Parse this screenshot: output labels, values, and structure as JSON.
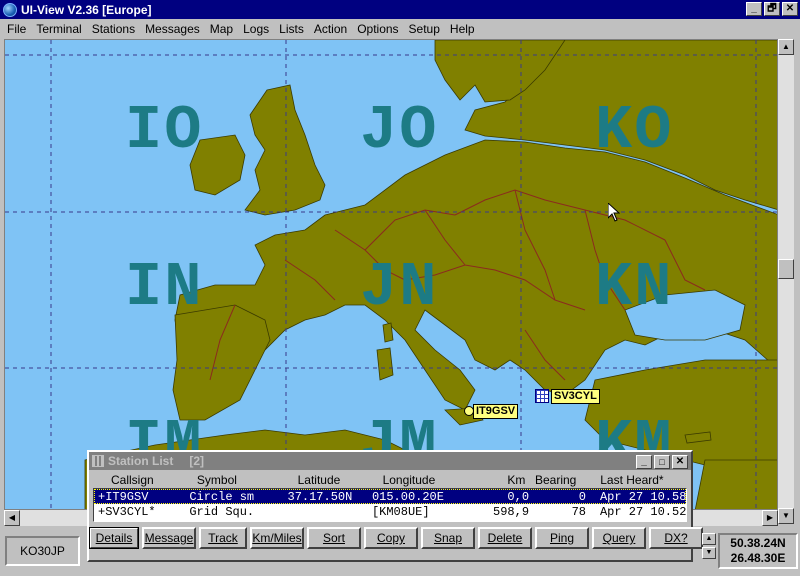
{
  "window": {
    "title": "UI-View V2.36 [Europe]",
    "buttons": [
      "_",
      "🗗",
      "✕"
    ]
  },
  "menu": [
    "File",
    "Terminal",
    "Stations",
    "Messages",
    "Map",
    "Logs",
    "Lists",
    "Action",
    "Options",
    "Setup",
    "Help"
  ],
  "map": {
    "grid_squares": [
      "IO",
      "JO",
      "KO",
      "IN",
      "JN",
      "KN",
      "IM",
      "JM",
      "KM"
    ],
    "stations": [
      {
        "callsign": "IT9GSV",
        "symbol": "circle"
      },
      {
        "callsign": "SV3CYL",
        "symbol": "grid"
      }
    ],
    "colors": {
      "sea": "#7fc3f5",
      "land": "#808000",
      "grid_labels": "#1d7b85",
      "borders": "#8b2a1e"
    }
  },
  "station_list": {
    "title": "Station List",
    "count": "[2]",
    "columns": [
      "Callsign",
      "Symbol",
      "Latitude",
      "Longitude",
      "Km",
      "Bearing",
      "Last Heard*"
    ],
    "rows": [
      {
        "callsign": "+IT9GSV",
        "symbol": "Circle sm",
        "latitude": "37.17.50N",
        "longitude": "015.00.20E",
        "km": "0,0",
        "bearing": "0",
        "last_heard": "Apr 27 10.58",
        "selected": true
      },
      {
        "callsign": "+SV3CYL*",
        "symbol": "Grid Squ.",
        "latitude": "",
        "longitude": "[KM08UE]",
        "km": "598,9",
        "bearing": "78",
        "last_heard": "Apr 27 10.52",
        "selected": false
      }
    ],
    "buttons": [
      "Details",
      "Message",
      "Track",
      "Km/Miles",
      "Sort",
      "Copy",
      "Snap",
      "Delete",
      "Ping",
      "Query",
      "DX?"
    ]
  },
  "status": {
    "locator": "KO30JP",
    "latitude": "50.38.24N",
    "longitude": "26.48.30E"
  }
}
